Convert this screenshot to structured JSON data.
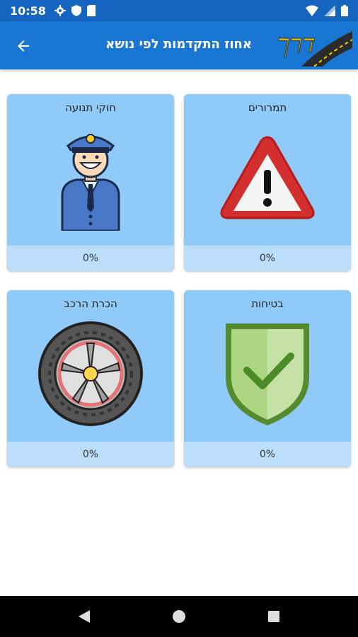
{
  "status": {
    "time": "10:58"
  },
  "header": {
    "title": "אחוז התקדמות לפי נושא"
  },
  "topics": [
    {
      "title": "תמרורים",
      "progress": "0%",
      "icon": "warning-sign-icon"
    },
    {
      "title": "חוקי תנועה",
      "progress": "0%",
      "icon": "police-officer-icon"
    },
    {
      "title": "בטיחות",
      "progress": "0%",
      "icon": "shield-check-icon"
    },
    {
      "title": "הכרת הרכב",
      "progress": "0%",
      "icon": "tire-wheel-icon"
    }
  ],
  "colors": {
    "status_bar": "#1565c0",
    "app_bar": "#1976d2",
    "card": "#90caf9",
    "card_footer": "#bbdefb"
  }
}
